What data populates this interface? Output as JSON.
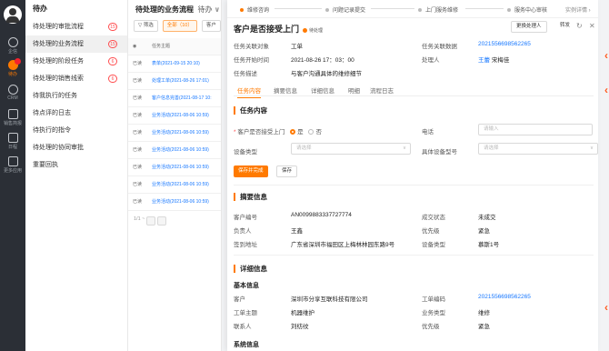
{
  "rail": {
    "items": [
      {
        "label": "企信"
      },
      {
        "label": "待办"
      },
      {
        "label": "CRM"
      },
      {
        "label": "销售简报"
      },
      {
        "label": "日程"
      },
      {
        "label": "更多应用"
      }
    ]
  },
  "todo": {
    "title": "待办",
    "items": [
      {
        "label": "待处理的审批流程",
        "badge": "15"
      },
      {
        "label": "待处理的业务流程",
        "badge": "15"
      },
      {
        "label": "待处理的阶段任务",
        "badge": "6"
      },
      {
        "label": "待处理的销售线索",
        "badge": "6"
      },
      {
        "label": "待我执行的任务",
        "badge": ""
      },
      {
        "label": "待点评的日志",
        "badge": ""
      },
      {
        "label": "待执行的指令",
        "badge": ""
      },
      {
        "label": "待处理的协同审批",
        "badge": ""
      },
      {
        "label": "重要回执",
        "badge": ""
      }
    ]
  },
  "biz": {
    "title": "待处理的业务流程",
    "title_suffix": "待办",
    "filter_label": "筛选",
    "all_label": "全部（10）",
    "cust_label": "客户",
    "col_main": "任务主题",
    "rows": [
      {
        "status": "已读",
        "subject": "表单(2021-09-15 20:10)"
      },
      {
        "status": "已读",
        "subject": "处理工单(2021-08-26 17:01)"
      },
      {
        "status": "已读",
        "subject": "客户信息完善(2021-08-17 10:"
      },
      {
        "status": "已读",
        "subject": "业务活动(2021-08-06 10:59)"
      },
      {
        "status": "已读",
        "subject": "业务活动(2021-08-06 10:59)"
      },
      {
        "status": "已读",
        "subject": "业务活动(2021-08-06 10:59)"
      },
      {
        "status": "已读",
        "subject": "业务活动(2021-08-06 10:59)"
      },
      {
        "status": "已读",
        "subject": "业务活动(2021-08-06 10:59)"
      },
      {
        "status": "已读",
        "subject": "业务活动(2021-08-06 10:59)"
      }
    ],
    "pager": "1/1 ~"
  },
  "detail": {
    "steps": [
      "维修咨询",
      "问题记录提交",
      "上门服务维修",
      "服务中心审核"
    ],
    "instance_link": "实例详情 ›",
    "title": "客户是否接受上门",
    "status": "待处理",
    "change_handler": "更换处理人",
    "forward": "转发",
    "refresh_icon": "refresh-icon",
    "close_icon": "close-icon",
    "info": {
      "obj_k": "任务关联对象",
      "obj_v": "工单",
      "data_k": "任务关联数据",
      "data_v": "2021556698562265",
      "start_k": "任务开始时间",
      "start_v": "2021-08-26 17：03：00",
      "handler_k": "处理人",
      "handler_v1": "王蕾",
      "handler_v2": "宋梅佳",
      "desc_k": "任务描述",
      "desc_v": "与客户沟通具体的维修细节"
    },
    "tabs": [
      "任务内容",
      "摘要信息",
      "详细信息",
      "明细",
      "流程日志"
    ],
    "task": {
      "section": "任务内容",
      "accept_label": "客户是否接受上门",
      "yes": "是",
      "no": "否",
      "phone_label": "电话",
      "phone_placeholder": "请输入",
      "device_type_label": "设备类型",
      "device_type_placeholder": "请选择",
      "device_model_label": "具体设备型号",
      "device_model_placeholder": "请选择",
      "save_complete": "保存并完成",
      "save": "保存"
    },
    "summary": {
      "section": "摘要信息",
      "rows": [
        {
          "k1": "客户编号",
          "v1": "AN0099883337727774",
          "k2": "成交状态",
          "v2": "未成交"
        },
        {
          "k1": "负责人",
          "v1": "王鑫",
          "k2": "优先级",
          "v2": "紧急"
        },
        {
          "k1": "签到地址",
          "v1": "广东省深圳市福田区上梅林林园东路9号",
          "k2": "设备类型",
          "v2": "慕斯1号"
        }
      ]
    },
    "details": {
      "section": "详细信息",
      "basic": "基本信息",
      "rows": [
        {
          "k1": "客户",
          "v1": "深圳市分享互联科技有限公司",
          "k2": "工单编码",
          "v2": "2021556698562265"
        },
        {
          "k1": "工单主题",
          "v1": "机器维护",
          "k2": "业务类型",
          "v2": "维修"
        },
        {
          "k1": "联系人",
          "v1": "刘纺纹",
          "k2": "优先级",
          "v2": "紧急"
        }
      ],
      "system": "系统信息"
    }
  },
  "colors": {
    "accent": "#ff7a00",
    "link": "#1677ff",
    "annotation_arrow": "#ff5a1f"
  }
}
